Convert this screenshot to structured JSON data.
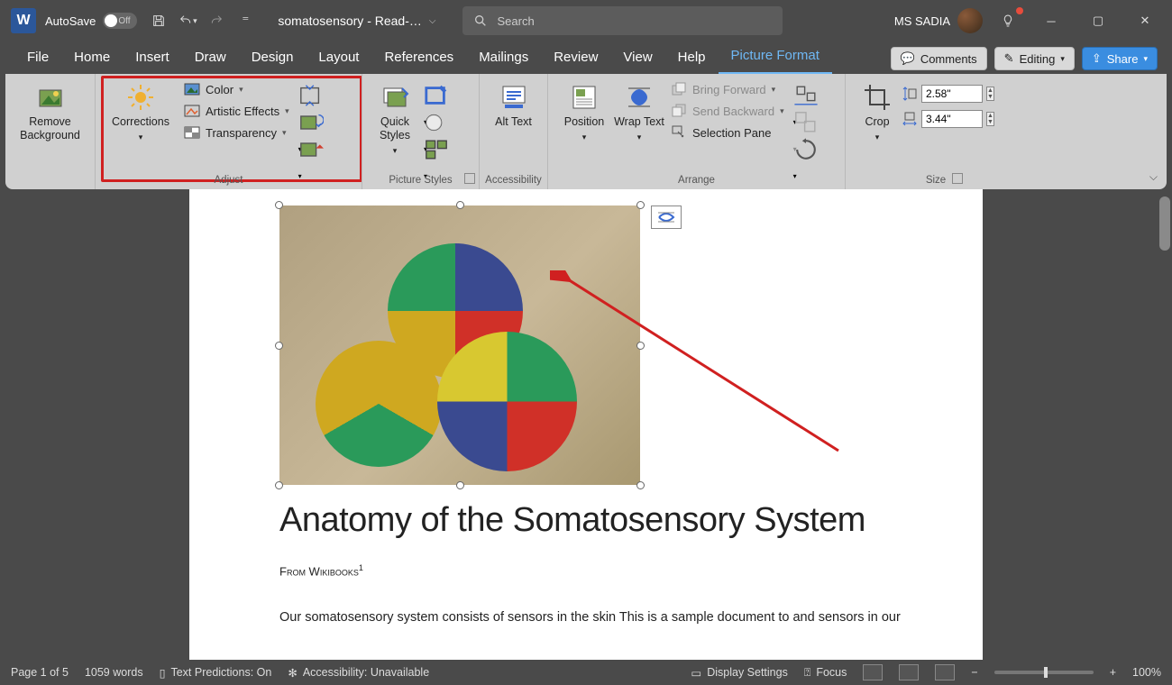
{
  "titlebar": {
    "autosave_label": "AutoSave",
    "autosave_state": "Off",
    "doc_title": "somatosensory  -  Read-…",
    "search_placeholder": "Search",
    "user_name": "MS SADIA"
  },
  "tabs": {
    "items": [
      "File",
      "Home",
      "Insert",
      "Draw",
      "Design",
      "Layout",
      "References",
      "Mailings",
      "Review",
      "View",
      "Help",
      "Picture Format"
    ],
    "active_index": 11,
    "comments": "Comments",
    "editing": "Editing",
    "share": "Share"
  },
  "ribbon": {
    "remove_bg": "Remove Background",
    "corrections": "Corrections",
    "color": "Color",
    "artistic": "Artistic Effects",
    "transparency": "Transparency",
    "adjust_label": "Adjust",
    "quick_styles": "Quick Styles",
    "picture_styles_label": "Picture Styles",
    "alt_text": "Alt Text",
    "accessibility_label": "Accessibility",
    "position": "Position",
    "wrap_text": "Wrap Text",
    "bring_forward": "Bring Forward",
    "send_backward": "Send Backward",
    "selection_pane": "Selection Pane",
    "arrange_label": "Arrange",
    "crop": "Crop",
    "height_value": "2.58\"",
    "width_value": "3.44\"",
    "size_label": "Size"
  },
  "document": {
    "heading": "Anatomy of the Somatosensory System",
    "subheading": "From Wikibooks",
    "sup": "1",
    "body": "Our somatosensory system consists of sensors in the skin This is a sample document to and sensors in our"
  },
  "statusbar": {
    "page": "Page 1 of 5",
    "words": "1059 words",
    "predictions": "Text Predictions: On",
    "accessibility": "Accessibility: Unavailable",
    "display": "Display Settings",
    "focus": "Focus",
    "zoom": "100%"
  }
}
